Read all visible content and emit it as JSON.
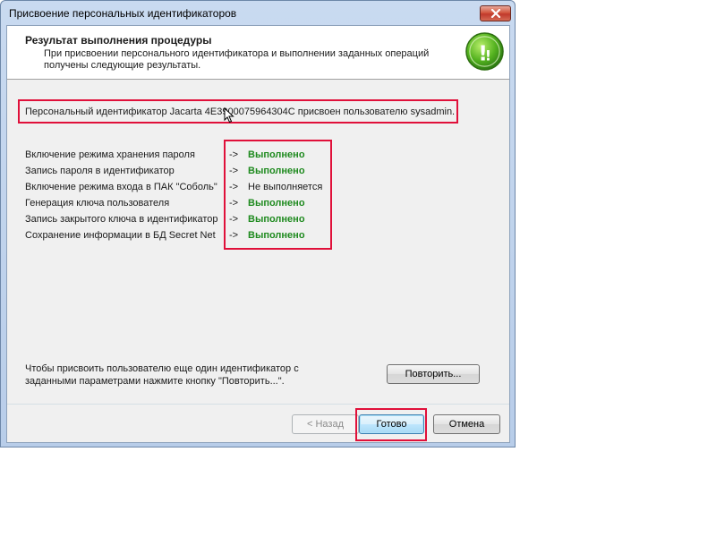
{
  "window": {
    "title": "Присвоение персональных идентификаторов"
  },
  "header": {
    "title": "Результат выполнения процедуры",
    "description": "При присвоении персонального идентификатора и выполнении заданных операций получены следующие результаты."
  },
  "result": {
    "message": "Персональный идентификатор Jacarta 4E3900075964304C присвоен пользователю sysadmin."
  },
  "operations": [
    {
      "label": "Включение режима хранения пароля",
      "arrow": "->",
      "status": "Выполнено",
      "done": true
    },
    {
      "label": "Запись пароля в идентификатор",
      "arrow": "->",
      "status": "Выполнено",
      "done": true
    },
    {
      "label": "Включение режима входа в ПАК \"Соболь\"",
      "arrow": "->",
      "status": "Не выполняется",
      "done": false
    },
    {
      "label": "Генерация ключа пользователя",
      "arrow": "->",
      "status": "Выполнено",
      "done": true
    },
    {
      "label": "Запись закрытого ключа в идентификатор",
      "arrow": "->",
      "status": "Выполнено",
      "done": true
    },
    {
      "label": "Сохранение информации в БД Secret Net",
      "arrow": "->",
      "status": "Выполнено",
      "done": true
    }
  ],
  "repeat": {
    "hint": "Чтобы присвоить пользователю еще один идентификатор с заданными параметрами нажмите кнопку \"Повторить...\".",
    "button_label": "Повторить..."
  },
  "footer": {
    "back_label": "< Назад",
    "done_label": "Готово",
    "cancel_label": "Отмена"
  },
  "colors": {
    "success": "#1e8a1e",
    "highlight": "#e0103a",
    "close_button": "#c0392b"
  }
}
